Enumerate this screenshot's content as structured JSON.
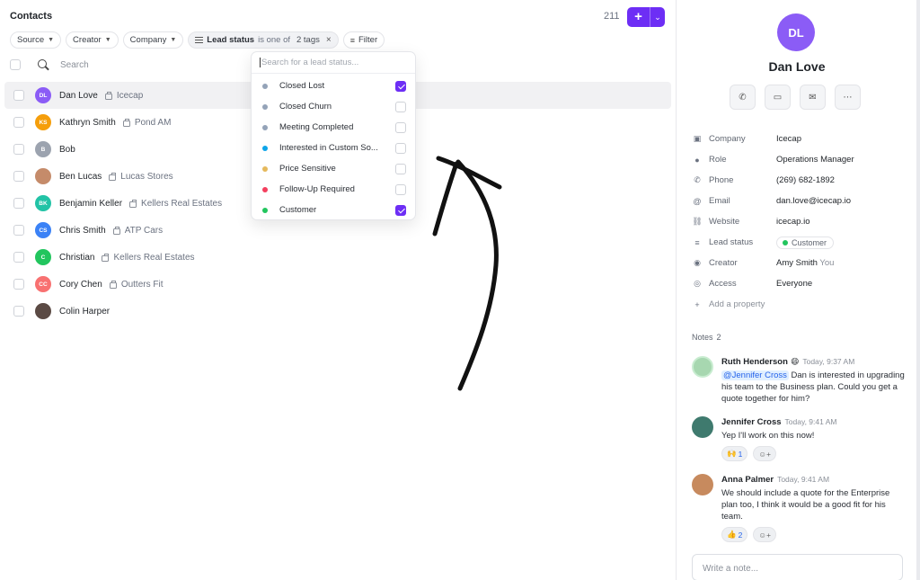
{
  "header": {
    "title": "Contacts",
    "count": "211",
    "add_label": "+",
    "add_menu_label": "⌄"
  },
  "filters": {
    "source": "Source",
    "creator": "Creator",
    "company": "Company",
    "lead_status": {
      "label": "Lead status",
      "operator": "is one of",
      "value": "2 tags",
      "remove": "×"
    },
    "filter_button": "Filter"
  },
  "search": {
    "placeholder": "Search"
  },
  "contacts": [
    {
      "initials": "DL",
      "name": "Dan Love",
      "company": "Icecap",
      "avatar_color": "#8b5cf6",
      "selected": true
    },
    {
      "initials": "KS",
      "name": "Kathryn Smith",
      "company": "Pond AM",
      "avatar_color": "#f59e0b"
    },
    {
      "initials": "B",
      "name": "Bob",
      "company": "",
      "avatar_color": "#9ca3af"
    },
    {
      "initials": "",
      "name": "Ben Lucas",
      "company": "Lucas Stores",
      "avatar_color": "#c58b6a"
    },
    {
      "initials": "BK",
      "name": "Benjamin Keller",
      "company": "Kellers Real Estates",
      "avatar_color": "#22c3a6"
    },
    {
      "initials": "CS",
      "name": "Chris Smith",
      "company": "ATP Cars",
      "avatar_color": "#3b82f6"
    },
    {
      "initials": "C",
      "name": "Christian",
      "company": "Kellers Real Estates",
      "avatar_color": "#22c55e"
    },
    {
      "initials": "CC",
      "name": "Cory Chen",
      "company": "Outters Fit",
      "avatar_color": "#f87171"
    },
    {
      "initials": "",
      "name": "Colin Harper",
      "company": "",
      "avatar_color": "#5b4a44"
    }
  ],
  "lead_status_dropdown": {
    "placeholder": "Search for a lead status...",
    "options": [
      {
        "label": "Closed Lost",
        "color": "#94a3b8",
        "checked": true
      },
      {
        "label": "Closed Churn",
        "color": "#94a3b8",
        "checked": false
      },
      {
        "label": "Meeting Completed",
        "color": "#94a3b8",
        "checked": false
      },
      {
        "label": "Interested in Custom So...",
        "color": "#0ea5e9",
        "checked": false
      },
      {
        "label": "Price Sensitive",
        "color": "#e5b95c",
        "checked": false
      },
      {
        "label": "Follow-Up Required",
        "color": "#f43f5e",
        "checked": false
      },
      {
        "label": "Customer",
        "color": "#22c55e",
        "checked": true
      }
    ]
  },
  "detail": {
    "initials": "DL",
    "name": "Dan Love",
    "properties": [
      {
        "label": "Company",
        "value": "Icecap"
      },
      {
        "label": "Role",
        "value": "Operations Manager"
      },
      {
        "label": "Phone",
        "value": "(269) 682-1892"
      },
      {
        "label": "Email",
        "value": "dan.love@icecap.io"
      },
      {
        "label": "Website",
        "value": "icecap.io"
      },
      {
        "label": "Lead status",
        "value": "Customer"
      },
      {
        "label": "Creator",
        "value": "Amy Smith",
        "sub": "You"
      },
      {
        "label": "Access",
        "value": "Everyone"
      }
    ],
    "add_property": "Add a property"
  },
  "notes": {
    "label": "Notes",
    "count": "2",
    "items": [
      {
        "author": "Ruth Henderson",
        "emoji": "😄",
        "time": "Today, 9:37 AM",
        "mention": "@Jennifer Cross",
        "text": " Dan is interested in upgrading his team to the Business plan. Could you get a quote together for him?"
      },
      {
        "author": "Jennifer Cross",
        "time": "Today, 9:41 AM",
        "text": "Yep I'll work on this now!",
        "reaction": "🙌",
        "reaction_count": "1"
      },
      {
        "author": "Anna Palmer",
        "time": "Today, 9:41 AM",
        "text": "We should include a quote for the Enterprise plan too, I think it would be a good fit for his team.",
        "reaction": "👍",
        "reaction_count": "2"
      }
    ],
    "write_placeholder": "Write a note..."
  }
}
